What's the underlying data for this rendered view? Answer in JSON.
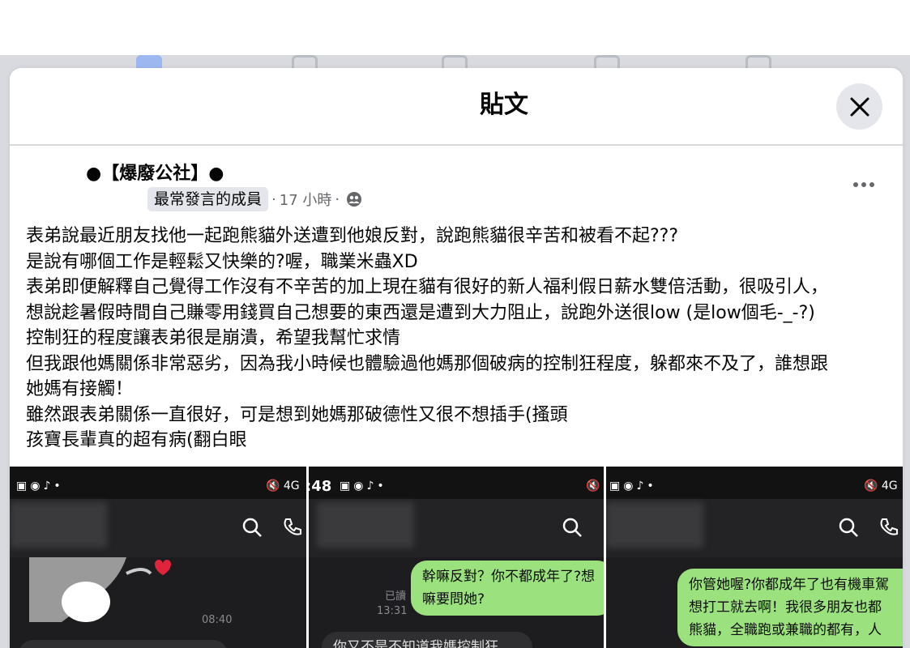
{
  "modal": {
    "title": "貼文",
    "close_label": "關閉"
  },
  "post": {
    "group_name": "●【爆廢公社】●",
    "badge": "最常發言的成員",
    "sep1": "·",
    "time": "17 小時",
    "sep2": "·",
    "audience_icon": "group-icon",
    "lines": [
      "表弟說最近朋友找他一起跑熊貓外送遭到他娘反對，說跑熊貓很辛苦和被看不起???",
      "是說有哪個工作是輕鬆又快樂的?喔，職業米蟲XD",
      "表弟即便解釋自己覺得工作沒有不辛苦的加上現在貓有很好的新人福利假日薪水雙倍活動，很吸引人，",
      "想說趁暑假時間自己賺零用錢買自己想要的東西還是遭到大力阻止，說跑外送很low (是low個毛-_-?)",
      "控制狂的程度讓表弟很是崩潰，希望我幫忙求情",
      "但我跟他媽關係非常惡劣，因為我小時候也體驗過他媽那個破病的控制狂程度，躲都來不及了，誰想跟",
      "她媽有接觸！",
      "雖然跟表弟關係一直很好，可是想到她媽那破德性又很不想插手(搔頭",
      "孩寶長輩真的超有病(翻白眼"
    ]
  },
  "photos": [
    {
      "time": "",
      "msg_time": "08:40"
    },
    {
      "time": ":48",
      "read_label": "已讀",
      "read_time": "13:31",
      "green_bubble": [
        "幹嘛反對？你不都成年了?想",
        "嘛要問她?"
      ],
      "dark_bubble": "你又不是不知道我媽控制狂"
    },
    {
      "time": "",
      "green_bubble": [
        "你管她喔?你都成年了也有機車駕",
        "想打工就去啊！我很多朋友也都",
        "熊貓，全職跑或兼職的都有，人"
      ]
    }
  ],
  "colors": {
    "badge_bg": "#e4e6eb",
    "chat_green": "#9be27e",
    "chat_bg": "#1d1d1f"
  }
}
